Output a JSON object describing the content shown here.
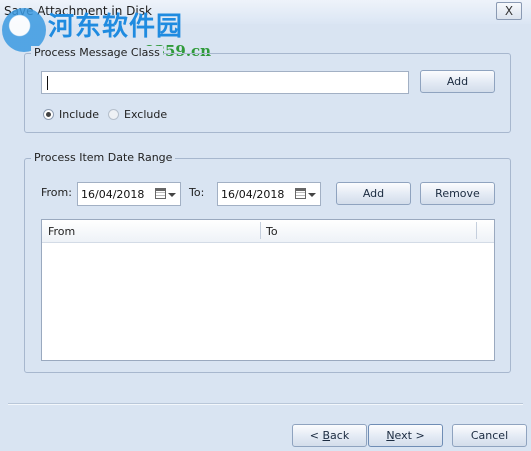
{
  "window": {
    "title": "Save Attachment in Disk",
    "close_glyph": "X"
  },
  "watermark": {
    "title": "河东软件园",
    "url": "www.pc0359.cn"
  },
  "message_class": {
    "legend": "Process Message Class",
    "input_value": "",
    "add_label": "Add",
    "include_label": "Include",
    "exclude_label": "Exclude",
    "selected": "Include"
  },
  "date_range": {
    "legend": "Process Item Date Range",
    "from_label": "From:",
    "from_value": "16/04/2018",
    "to_label": "To:",
    "to_value": "16/04/2018",
    "add_label": "Add",
    "remove_label": "Remove",
    "columns": [
      "From",
      "To"
    ],
    "rows": []
  },
  "footer": {
    "back_prefix": "< ",
    "back_mnemonic": "B",
    "back_rest": "ack",
    "next_mnemonic": "N",
    "next_rest": "ext >",
    "cancel_label": "Cancel"
  }
}
